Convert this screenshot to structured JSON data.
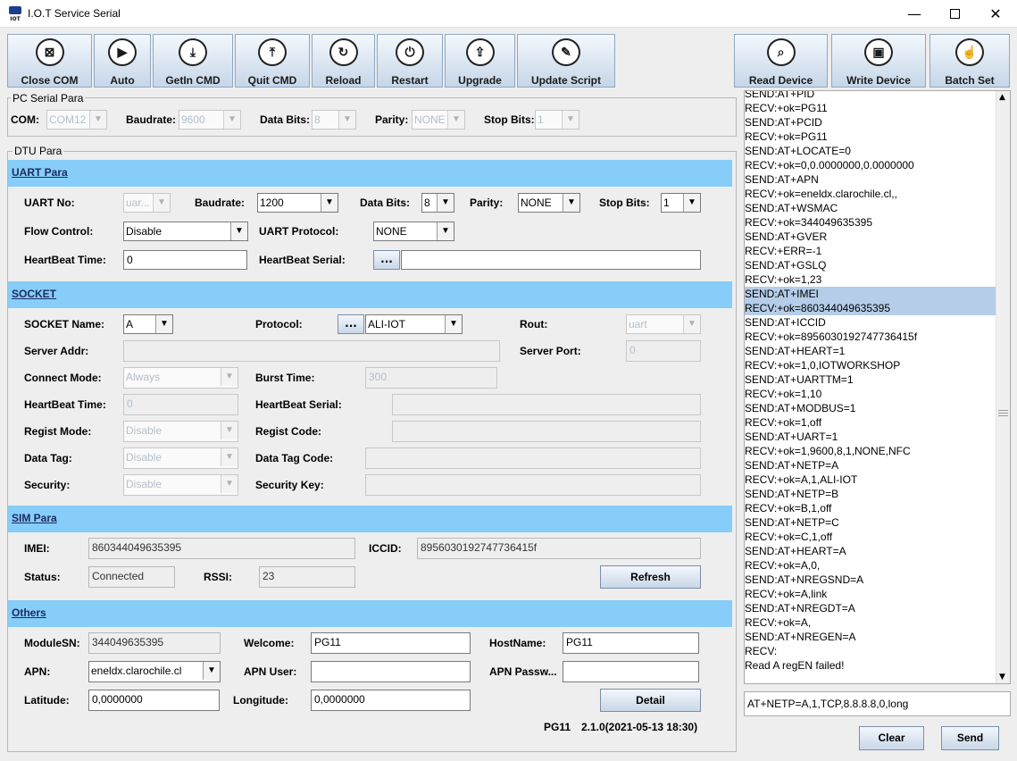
{
  "window": {
    "title": "I.O.T Service Serial",
    "logo": "IOT"
  },
  "toolbar": [
    {
      "label": "Close COM",
      "icon": "close-box-icon"
    },
    {
      "label": "Auto",
      "icon": "play-icon"
    },
    {
      "label": "GetIn CMD",
      "icon": "download-tray-icon"
    },
    {
      "label": "Quit CMD",
      "icon": "upload-tray-icon"
    },
    {
      "label": "Reload",
      "icon": "reload-doc-icon"
    },
    {
      "label": "Restart",
      "icon": "power-icon"
    },
    {
      "label": "Upgrade",
      "icon": "upgrade-arrow-icon"
    },
    {
      "label": "Update Script",
      "icon": "script-scroll-icon"
    },
    {
      "label": "Read Device",
      "icon": "read-device-icon"
    },
    {
      "label": "Write Device",
      "icon": "save-disk-icon"
    },
    {
      "label": "Batch Set",
      "icon": "hand-pointer-icon"
    }
  ],
  "pc_serial": {
    "title": "PC Serial Para",
    "com_label": "COM:",
    "com": "COM12",
    "baud_label": "Baudrate:",
    "baud": "9600",
    "databits_label": "Data Bits:",
    "databits": "8",
    "parity_label": "Parity:",
    "parity": "NONE",
    "stopbits_label": "Stop Bits:",
    "stopbits": "1"
  },
  "dtu": {
    "title": "DTU Para"
  },
  "uart": {
    "title": "UART Para",
    "no_label": "UART No:",
    "no": "uar...",
    "baud_label": "Baudrate:",
    "baud": "1200",
    "databits_label": "Data Bits:",
    "databits": "8",
    "parity_label": "Parity:",
    "parity": "NONE",
    "stopbits_label": "Stop Bits:",
    "stopbits": "1",
    "flow_label": "Flow Control:",
    "flow": "Disable",
    "protocol_label": "UART Protocol:",
    "protocol": "NONE",
    "hb_time_label": "HeartBeat Time:",
    "hb_time": "0",
    "hb_serial_label": "HeartBeat Serial:",
    "hb_serial": "",
    "dots": "..."
  },
  "socket": {
    "title": "SOCKET",
    "name_label": "SOCKET Name:",
    "name": "A",
    "protocol_label": "Protocol:",
    "protocol": "ALI-IOT",
    "rout_label": "Rout:",
    "rout": "uart",
    "addr_label": "Server Addr:",
    "addr": "",
    "port_label": "Server Port:",
    "port": "0",
    "connect_label": "Connect Mode:",
    "connect": "Always",
    "burst_label": "Burst Time:",
    "burst": "300",
    "hb_time_label": "HeartBeat Time:",
    "hb_time": "0",
    "hb_serial_label": "HeartBeat Serial:",
    "hb_serial": "",
    "regist_label": "Regist Mode:",
    "regist": "Disable",
    "regist_code_label": "Regist Code:",
    "regist_code": "",
    "datatag_label": "Data Tag:",
    "datatag": "Disable",
    "datatag_code_label": "Data Tag Code:",
    "datatag_code": "",
    "security_label": "Security:",
    "security": "Disable",
    "seckey_label": "Security Key:",
    "seckey": "",
    "dots": "..."
  },
  "sim": {
    "title": "SIM Para",
    "imei_label": "IMEI:",
    "imei": "860344049635395",
    "iccid_label": "ICCID:",
    "iccid": "8956030192747736415f",
    "status_label": "Status:",
    "status": "Connected",
    "rssi_label": "RSSI:",
    "rssi": "23",
    "refresh": "Refresh"
  },
  "others": {
    "title": "Others",
    "sn_label": "ModuleSN:",
    "sn": "344049635395",
    "welcome_label": "Welcome:",
    "welcome": "PG11",
    "host_label": "HostName:",
    "host": "PG11",
    "apn_label": "APN:",
    "apn": "eneldx.clarochile.cl",
    "apnuser_label": "APN User:",
    "apnuser": "",
    "apnpass_label": "APN Passw...",
    "apnpass": "",
    "lat_label": "Latitude:",
    "lat": "0,0000000",
    "lon_label": "Longitude:",
    "lon": "0,0000000",
    "detail": "Detail"
  },
  "footer": {
    "model": "PG11",
    "version": "2.1.0(2021-05-13 18:30)"
  },
  "log": {
    "lines": [
      "SEND:AT+PID",
      "RECV:+ok=PG11",
      "SEND:AT+PCID",
      "RECV:+ok=PG11",
      "SEND:AT+LOCATE=0",
      "RECV:+ok=0,0.0000000,0.0000000",
      "SEND:AT+APN",
      "RECV:+ok=eneldx.clarochile.cl,,",
      "SEND:AT+WSMAC",
      "RECV:+ok=344049635395",
      "SEND:AT+GVER",
      "RECV:+ERR=-1",
      "SEND:AT+GSLQ",
      "RECV:+ok=1,23",
      "SEND:AT+IMEI",
      "RECV:+ok=860344049635395",
      "SEND:AT+ICCID",
      "RECV:+ok=8956030192747736415f",
      "SEND:AT+HEART=1",
      "RECV:+ok=1,0,IOTWORKSHOP",
      "SEND:AT+UARTTM=1",
      "RECV:+ok=1,10",
      "SEND:AT+MODBUS=1",
      "RECV:+ok=1,off",
      "SEND:AT+UART=1",
      "RECV:+ok=1,9600,8,1,NONE,NFC",
      "SEND:AT+NETP=A",
      "RECV:+ok=A,1,ALI-IOT",
      "SEND:AT+NETP=B",
      "RECV:+ok=B,1,off",
      "SEND:AT+NETP=C",
      "RECV:+ok=C,1,off",
      "SEND:AT+HEART=A",
      "RECV:+ok=A,0,",
      "SEND:AT+NREGSND=A",
      "RECV:+ok=A,link",
      "SEND:AT+NREGDT=A",
      "RECV:+ok=A,",
      "SEND:AT+NREGEN=A",
      "RECV:",
      "Read A regEN failed!"
    ],
    "selected": [
      14,
      15
    ]
  },
  "command": {
    "value": "AT+NETP=A,1,TCP,8.8.8.8,0,long",
    "clear": "Clear",
    "send": "Send"
  }
}
